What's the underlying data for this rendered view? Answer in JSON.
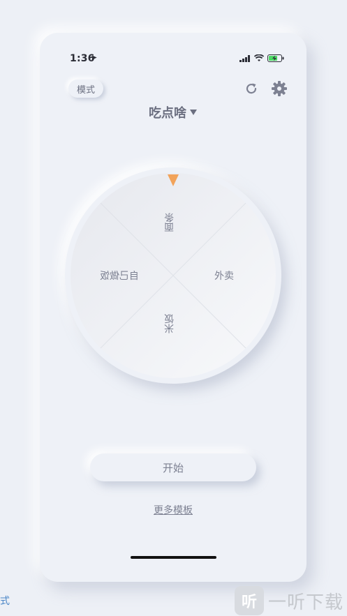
{
  "status_bar": {
    "time": "1:36",
    "location_icon": "location-arrow-icon"
  },
  "header": {
    "mode_label": "模式",
    "refresh_icon": "refresh-icon",
    "settings_icon": "gear-icon"
  },
  "title": {
    "text": "吃点啥",
    "dropdown_icon": "caret-down-icon"
  },
  "wheel": {
    "segments": [
      {
        "label": "面条",
        "orientation": "upside-down"
      },
      {
        "label": "外卖",
        "orientation": "upright"
      },
      {
        "label": "米饭",
        "orientation": "upside-down"
      },
      {
        "label": "自己做饭",
        "orientation": "upside-down"
      }
    ],
    "pointer_color": "#f2a35a"
  },
  "actions": {
    "start_label": "开始",
    "more_templates_label": "更多模板"
  },
  "outside": {
    "side_text": "式",
    "watermark_logo": "听",
    "watermark_text": "一听下载"
  }
}
